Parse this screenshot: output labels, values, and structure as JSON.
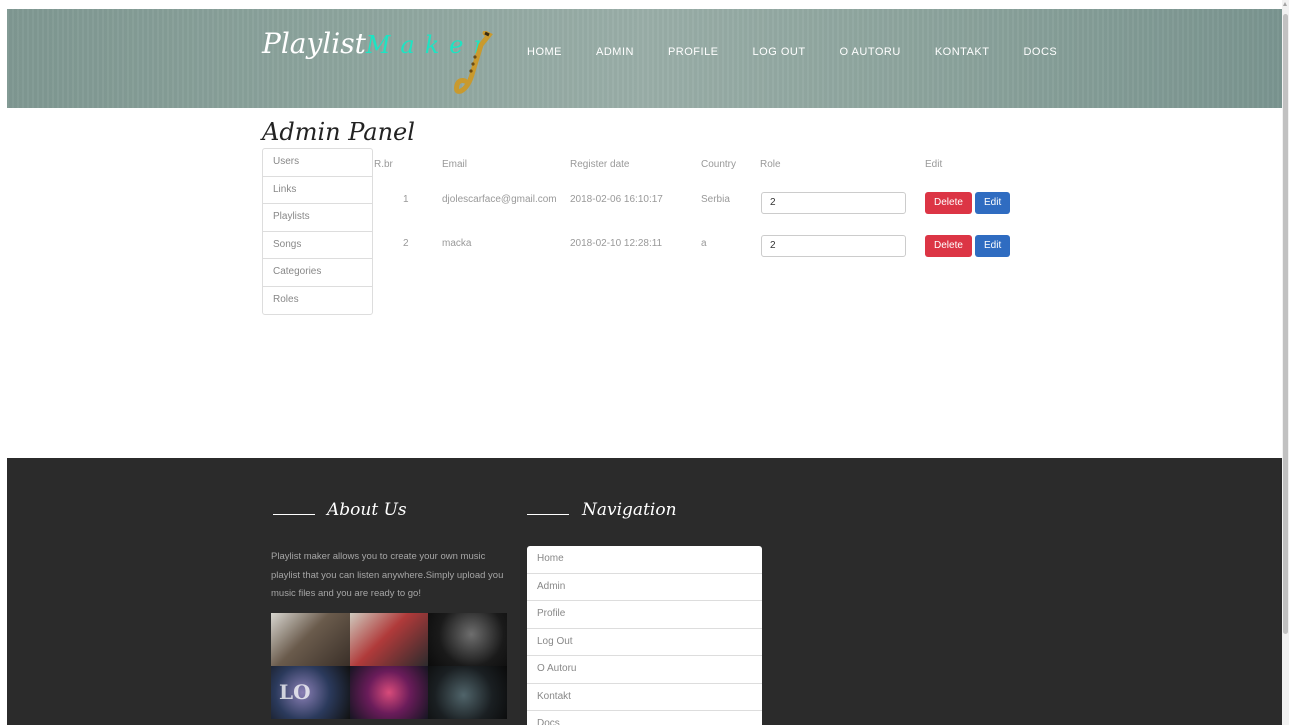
{
  "header": {
    "logo_main": "Playlist",
    "logo_accent": "Maker",
    "nav": [
      "HOME",
      "ADMIN",
      "PROFILE",
      "LOG OUT",
      "O AUTORU",
      "KONTAKT",
      "DOCS"
    ]
  },
  "admin": {
    "title": "Admin Panel",
    "side_items": [
      "Users",
      "Links",
      "Playlists",
      "Songs",
      "Categories",
      "Roles"
    ],
    "table": {
      "headers": [
        "R.br",
        "Email",
        "Register date",
        "Country",
        "Role",
        "Edit"
      ],
      "rows": [
        {
          "rbr": "1",
          "email": "djolescarface@gmail.com",
          "date": "2018-02-06 16:10:17",
          "country": "Serbia",
          "role": "2"
        },
        {
          "rbr": "2",
          "email": "macka",
          "date": "2018-02-10 12:28:11",
          "country": "a",
          "role": "2"
        }
      ],
      "delete_label": "Delete",
      "edit_label": "Edit"
    }
  },
  "footer": {
    "about_heading": "About Us",
    "about_text": "Playlist maker allows you to create your own music playlist that you can listen anywhere.Simply upload you music files and you are ready to go!",
    "photo_text": "LO",
    "nav_heading": "Navigation",
    "nav_items": [
      "Home",
      "Admin",
      "Profile",
      "Log Out",
      "O Autoru",
      "Kontakt",
      "Docs"
    ]
  },
  "colors": {
    "accent": "#1fe3c2",
    "delete": "#dc3545",
    "edit": "#2f6cc1",
    "footer_bg": "#2b2b2b"
  }
}
